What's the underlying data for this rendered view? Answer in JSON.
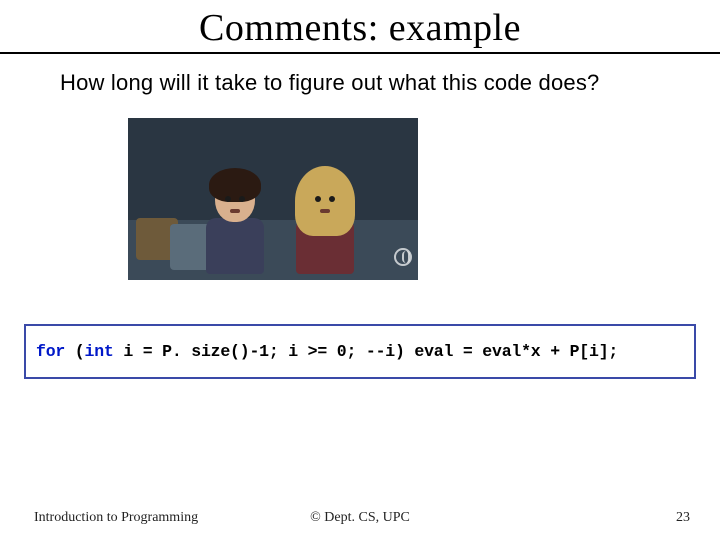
{
  "slide": {
    "title": "Comments: example",
    "subtitle": "How long will it take to figure out what this code does?"
  },
  "code": {
    "kw_for": "for",
    "paren_open": " (",
    "kw_int": "int",
    "rest": " i = P. size()-1; i >= 0; --i) eval = eval*x + P[i];"
  },
  "footer": {
    "left": "Introduction to Programming",
    "center": "© Dept. CS, UPC",
    "page": "23"
  },
  "image": {
    "alt": "Still frame of two people on a couch looking confused"
  }
}
